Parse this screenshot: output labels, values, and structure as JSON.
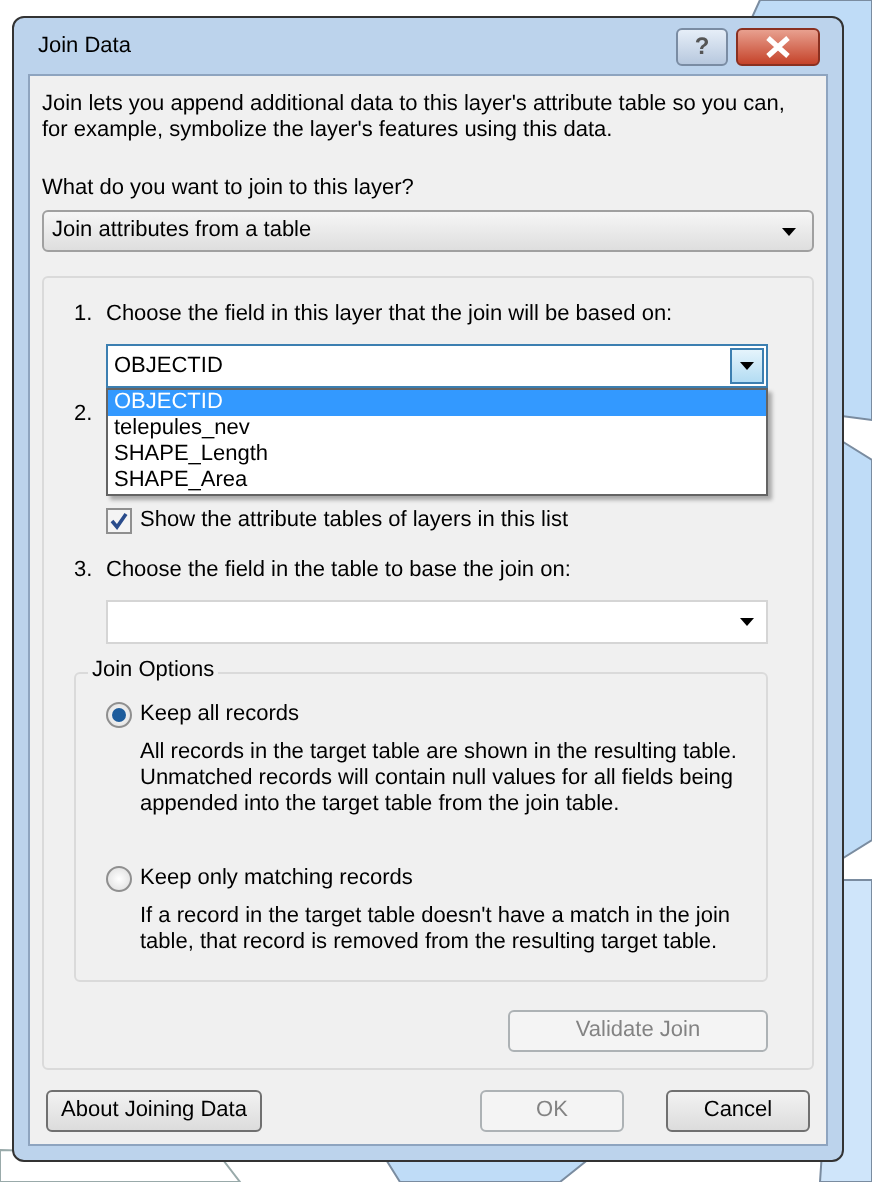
{
  "window": {
    "title": "Join Data",
    "help_button": "?"
  },
  "intro": "Join lets you append additional data to this layer's attribute table so you can, for example, symbolize the layer's features using this data.",
  "question": "What do you want to join to this layer?",
  "join_type": {
    "value": "Join attributes from a table"
  },
  "step_1": {
    "number": "1.",
    "label": "Choose the field in this layer that the join will be based on:",
    "field": {
      "value": "OBJECTID",
      "expanded": true
    },
    "options": [
      {
        "label": "OBJECTID",
        "selected": true
      },
      {
        "label": "telepules_nev",
        "selected": false
      },
      {
        "label": "SHAPE_Length",
        "selected": false
      },
      {
        "label": "SHAPE_Area",
        "selected": false
      }
    ]
  },
  "step_2": {
    "number": "2."
  },
  "show_attribute_tables": {
    "label": "Show the attribute tables of layers in this list",
    "checked": true
  },
  "step_3": {
    "number": "3.",
    "label": "Choose the field in the table to base the join on:"
  },
  "join_options": {
    "title": "Join Options",
    "options": [
      {
        "label": "Keep all records",
        "description": "All records in the target table are shown in the resulting table. Unmatched records will contain null values for all fields being appended into the target table from the join table.",
        "selected": true
      },
      {
        "label": "Keep only matching records",
        "description": "If a record in the target table doesn't have a match in the join table, that record is removed from the resulting target table.",
        "selected": false
      }
    ]
  },
  "validate_button": {
    "label": "Validate Join",
    "disabled": true
  },
  "buttons": [
    {
      "label": "About Joining Data",
      "disabled": false
    },
    {
      "label": "OK",
      "disabled": true
    },
    {
      "label": "Cancel",
      "disabled": false
    }
  ]
}
